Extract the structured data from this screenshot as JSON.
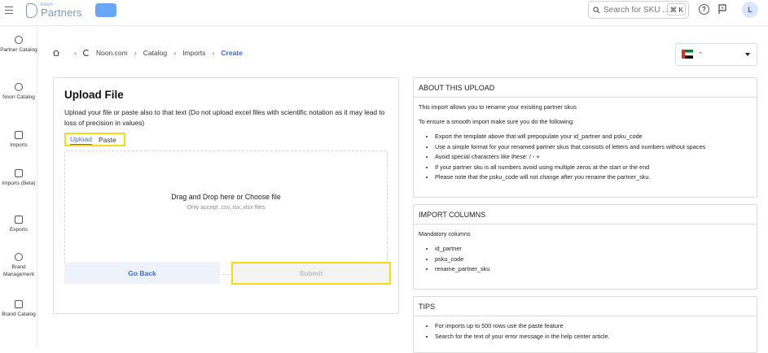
{
  "topbar": {
    "logo_small": "noon",
    "logo_big": "Partners",
    "search_placeholder": "Search for SKU ...",
    "shortcut": "⌘ K",
    "avatar_initial": "L"
  },
  "sidebar": {
    "items": [
      {
        "label": "Partner Catalog",
        "icon": "catalog-icon"
      },
      {
        "label": "Noon Catalog",
        "icon": "noon-catalog-icon"
      },
      {
        "label": "Imports",
        "icon": "imports-icon"
      },
      {
        "label": "Imports (Beta)",
        "icon": "imports-beta-icon"
      },
      {
        "label": "Exports",
        "icon": "exports-icon"
      },
      {
        "label": "Brand Management",
        "icon": "brand-management-icon"
      },
      {
        "label": "Brand Catalog",
        "icon": "brand-catalog-icon"
      }
    ]
  },
  "breadcrumb": {
    "items": [
      "Noon.com",
      "Catalog",
      "Imports",
      "Create"
    ]
  },
  "upload": {
    "title": "Upload File",
    "description": "Upload your file or paste also to that text (Do not upload excel files with scientific notation as it may lead to loss of precision in values)",
    "tabs": [
      "Upload",
      "Paste"
    ],
    "drop_text": "Drag and Drop here or Choose file",
    "drop_subtext": "Only accept .csv,.tsv,.xlsx files",
    "go_back": "Go Back",
    "submit": "Submit"
  },
  "about": {
    "title": "ABOUT THIS UPLOAD",
    "intro": "This import allows you to rename your exisiting partner skus",
    "lead": "To ensure a smooth import make sure you do the following:",
    "bullets": [
      "Export the template above that will prepopulate your id_partner and psku_code",
      "Use a simple format for your renamed partner skus that consists of letters and numbers without spaces",
      "Avoid special characters like these: / - +",
      "If your partner sku is all numbers avoid using multiple zeros at the start or the end",
      "Please note that the psku_code will not change after you rename the partner_sku."
    ]
  },
  "columns": {
    "title": "IMPORT COLUMNS",
    "lead": "Mandatory columns",
    "bullets": [
      "id_partner",
      "psku_code",
      "rename_partner_sku"
    ]
  },
  "tips": {
    "title": "TIPS",
    "bullets": [
      "For imports up to 500 rows use the paste feature",
      "Search for the text of your error message in the help center article."
    ]
  },
  "colors": {
    "accent": "#3c6bd6",
    "highlight": "#f2dd12",
    "chip": "#6aa6f7"
  }
}
